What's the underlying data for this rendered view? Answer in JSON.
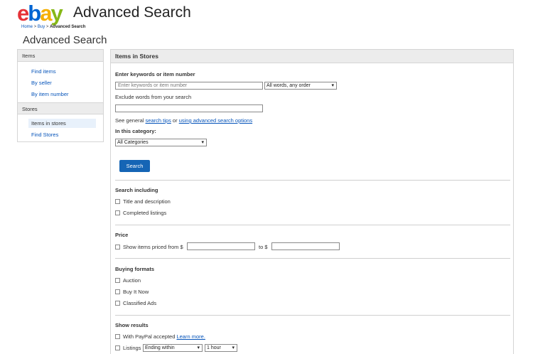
{
  "header": {
    "logo": {
      "e": "e",
      "b": "b",
      "a": "a",
      "y": "y"
    },
    "title": "Advanced Search"
  },
  "breadcrumb": {
    "home": "Home",
    "sep1": ">",
    "buy": "Buy",
    "sep2": ">",
    "current": "Advanced Search"
  },
  "page_title": "Advanced Search",
  "sidebar": {
    "items_heading": "Items",
    "items": [
      "Find items",
      "By seller",
      "By item number"
    ],
    "stores_heading": "Stores",
    "stores": [
      "Items in stores",
      "Find Stores"
    ],
    "selected": "Items in stores"
  },
  "main": {
    "heading": "Items in Stores",
    "keywords_label": "Enter keywords or item number",
    "keywords_placeholder": "Enter keywords or item number",
    "keywords_mode": "All words, any order",
    "exclude_label": "Exclude words from your search",
    "exclude_value": "",
    "tips": {
      "prefix": "See general",
      "link1": "search tips",
      "mid": "or",
      "link2": "using advanced search options"
    },
    "category_label": "In this category:",
    "category_value": "All Categories",
    "search_button": "Search",
    "search_including": {
      "heading": "Search including",
      "options": [
        "Title and description",
        "Completed listings"
      ]
    },
    "price": {
      "heading": "Price",
      "from_label": "Show items priced from $",
      "to_label": "to $"
    },
    "buying_formats": {
      "heading": "Buying formats",
      "options": [
        "Auction",
        "Buy It Now",
        "Classified Ads"
      ]
    },
    "show_results": {
      "heading": "Show results",
      "paypal_label": "With PayPal accepted",
      "paypal_link": "Learn more.",
      "listings_label": "Listings",
      "listings_select": "Ending within",
      "time_select": "1 hour"
    }
  },
  "colors": {
    "accent": "#1565b5",
    "link": "#0654ba",
    "panel_header": "#ececec"
  },
  "icons": {
    "dropdown": "chevron-down-icon",
    "checkbox": "checkbox-icon"
  }
}
